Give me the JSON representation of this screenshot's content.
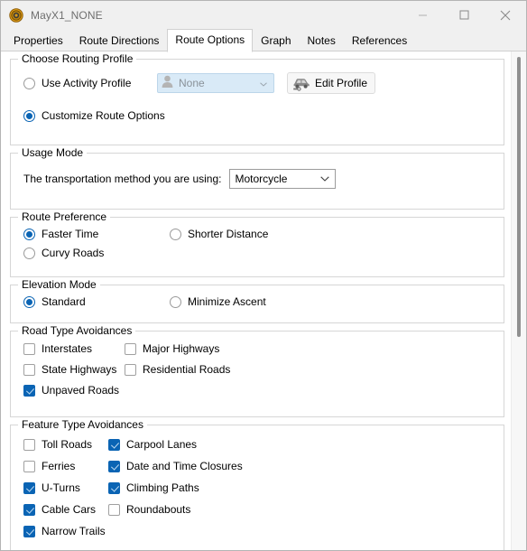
{
  "window": {
    "title": "MayX1_NONE",
    "icon": "compass-medal-icon",
    "minimize_label": "Minimize",
    "maximize_label": "Maximize",
    "close_label": "Close"
  },
  "tabs": [
    {
      "label": "Properties",
      "selected": false
    },
    {
      "label": "Route Directions",
      "selected": false
    },
    {
      "label": "Route Options",
      "selected": true
    },
    {
      "label": "Graph",
      "selected": false
    },
    {
      "label": "Notes",
      "selected": false
    },
    {
      "label": "References",
      "selected": false
    }
  ],
  "colors": {
    "accent_blue": "#0a64b4",
    "disabled_combo_bg": "#d9eaf7",
    "group_border": "#d6d6d6",
    "title_text": "#6e6e6e"
  },
  "groups": {
    "routing_profile": {
      "title": "Choose Routing Profile",
      "use_activity_profile": {
        "label": "Use Activity Profile",
        "checked": false
      },
      "customize_route_options": {
        "label": "Customize Route Options",
        "checked": true
      },
      "profile_combo": {
        "value": "None",
        "enabled": false,
        "icon": "person-icon"
      },
      "edit_profile_button": {
        "label": "Edit Profile",
        "icon": "car-wrench-icon"
      }
    },
    "usage_mode": {
      "title": "Usage Mode",
      "label": "The transportation method you are using:",
      "combo": {
        "value": "Motorcycle"
      }
    },
    "route_preference": {
      "title": "Route Preference",
      "options": [
        {
          "label": "Faster Time",
          "checked": true
        },
        {
          "label": "Shorter Distance",
          "checked": false
        },
        {
          "label": "Curvy Roads",
          "checked": false
        }
      ]
    },
    "elevation_mode": {
      "title": "Elevation Mode",
      "options": [
        {
          "label": "Standard",
          "checked": true
        },
        {
          "label": "Minimize Ascent",
          "checked": false
        }
      ]
    },
    "road_type_avoidances": {
      "title": "Road Type Avoidances",
      "items": [
        {
          "label": "Interstates",
          "checked": false
        },
        {
          "label": "Major Highways",
          "checked": false
        },
        {
          "label": "State Highways",
          "checked": false
        },
        {
          "label": "Residential Roads",
          "checked": false
        },
        {
          "label": "Unpaved Roads",
          "checked": true
        }
      ]
    },
    "feature_type_avoidances": {
      "title": "Feature Type Avoidances",
      "items": [
        {
          "label": "Toll Roads",
          "checked": false
        },
        {
          "label": "Carpool Lanes",
          "checked": true
        },
        {
          "label": "Ferries",
          "checked": false
        },
        {
          "label": "Date and Time Closures",
          "checked": true
        },
        {
          "label": "U-Turns",
          "checked": true
        },
        {
          "label": "Climbing Paths",
          "checked": true
        },
        {
          "label": "Cable Cars",
          "checked": true
        },
        {
          "label": "Roundabouts",
          "checked": false
        },
        {
          "label": "Narrow Trails",
          "checked": true
        }
      ]
    }
  },
  "scrollbar": {
    "orientation": "vertical",
    "name": "vertical-scrollbar"
  }
}
